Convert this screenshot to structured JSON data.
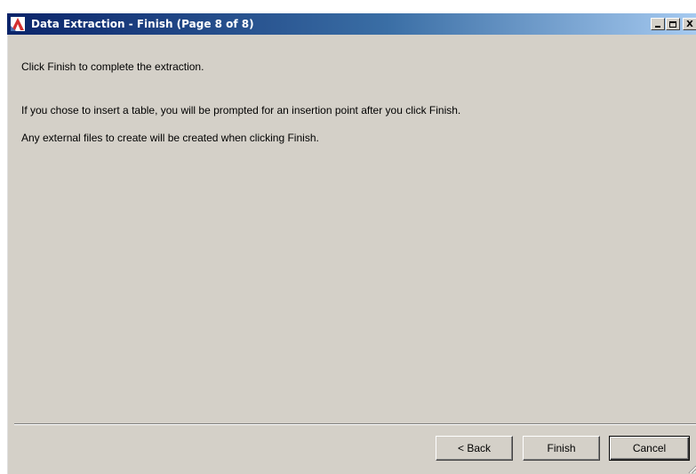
{
  "window": {
    "title": "Data Extraction - Finish (Page 8 of 8)",
    "icon": "autocad-icon",
    "caption_buttons": {
      "minimize": "minimize-icon",
      "maximize": "maximize-icon",
      "close_label": "X"
    }
  },
  "content": {
    "line1": "Click Finish to complete the extraction.",
    "line2": "If you chose to insert a table, you will be prompted for an insertion point after you click Finish.",
    "line3": "Any external files to create will be created when clicking Finish."
  },
  "buttons": {
    "back": "< Back",
    "finish": "Finish",
    "cancel": "Cancel"
  },
  "colors": {
    "dialog_bg": "#d4d0c8",
    "titlebar_start": "#0a246a",
    "titlebar_end": "#a6caf0",
    "icon_red": "#d32f2f"
  }
}
